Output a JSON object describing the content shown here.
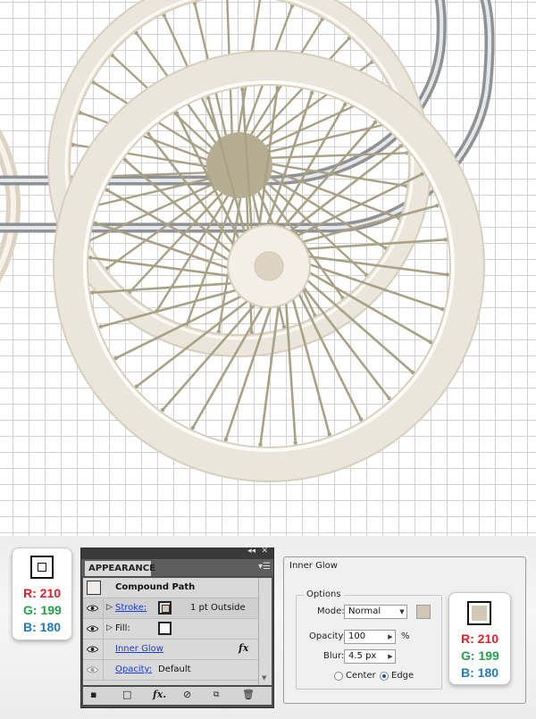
{
  "colors": {
    "fill": "#d2c7b4",
    "stroke": "#c8bca8",
    "spoke": "#a9a185",
    "hub": "#b5ad92",
    "rail": "#9c9ea2"
  },
  "swatch_left": {
    "r": "R: 210",
    "g": "G: 199",
    "b": "B: 180"
  },
  "swatch_right": {
    "r": "R: 210",
    "g": "G: 199",
    "b": "B: 180"
  },
  "appearance": {
    "tab": "APPEARANCE",
    "title": "Compound Path",
    "stroke_label": "Stroke:",
    "stroke_value": "1 pt  Outside",
    "fill_label": "Fill:",
    "effect_label": "Inner Glow",
    "fx_label": "fx",
    "opacity_label": "Opacity:",
    "opacity_value": "Default",
    "icons": [
      "eye-icon",
      "disclosure-triangle-icon",
      "fx-icon",
      "clear-appearance-icon",
      "duplicate-item-icon",
      "delete-item-icon"
    ]
  },
  "inner_glow": {
    "title": "Inner Glow",
    "group": "Options",
    "mode_label": "Mode:",
    "mode_value": "Normal",
    "opacity_label": "Opacity:",
    "opacity_value": "100",
    "opacity_unit": "%",
    "blur_label": "Blur:",
    "blur_value": "4.5 px",
    "center_label": "Center",
    "edge_label": "Edge",
    "selected_source": "Edge"
  }
}
